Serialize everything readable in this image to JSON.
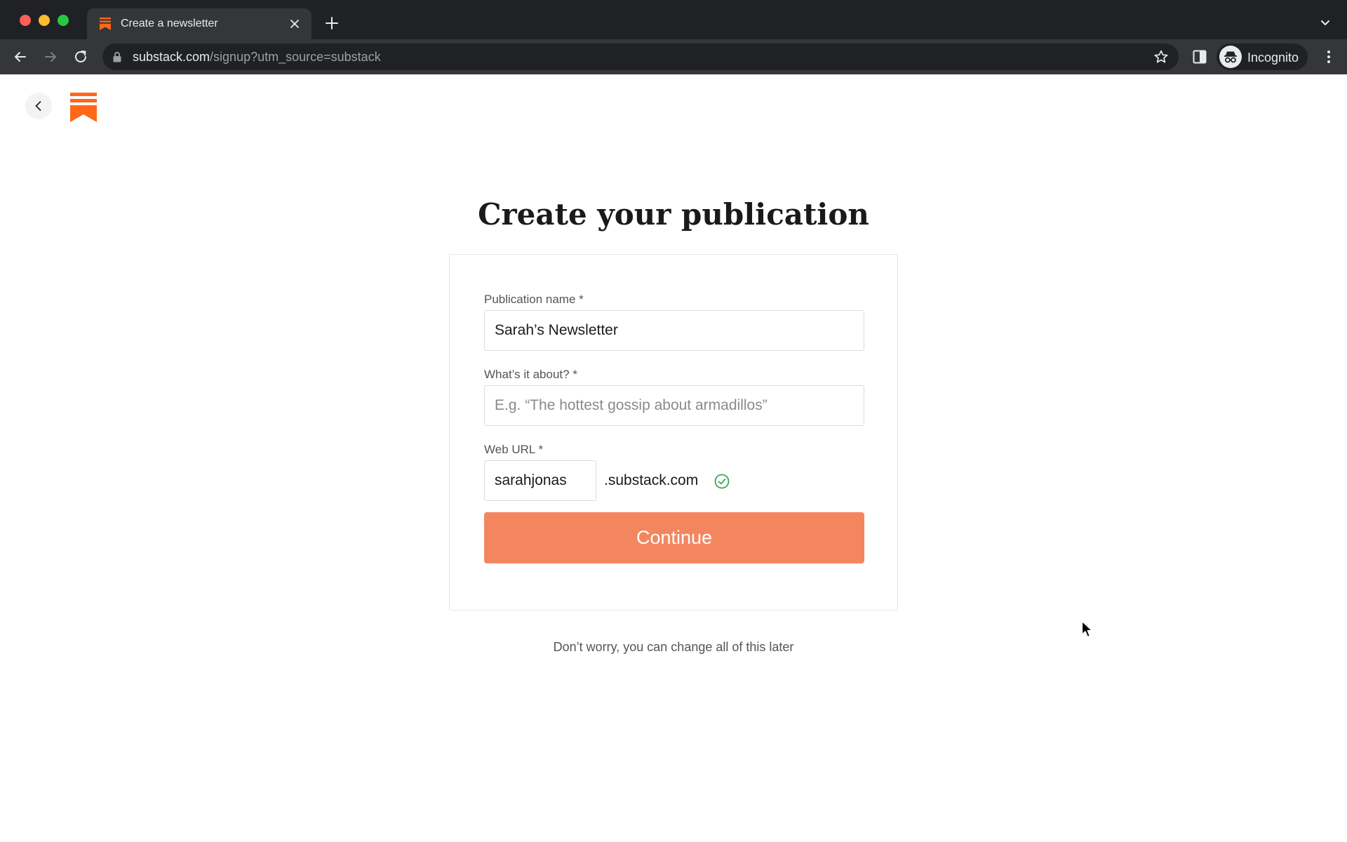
{
  "browser": {
    "tab": {
      "title": "Create a newsletter"
    },
    "address_bar": {
      "host": "substack.com",
      "path": "/signup?utm_source=substack"
    },
    "profile_label": "Incognito"
  },
  "page": {
    "title": "Create your publication",
    "form": {
      "publication_name": {
        "label": "Publication name *",
        "value": "Sarah’s Newsletter"
      },
      "about": {
        "label": "What’s it about? *",
        "placeholder": "E.g. “The hottest gossip about armadillos”",
        "value": ""
      },
      "web_url": {
        "label": "Web URL *",
        "value": "sarahjonas",
        "suffix": ".substack.com",
        "status": "available"
      },
      "submit_label": "Continue"
    },
    "footnote": "Don’t worry, you can change all of this later"
  },
  "colors": {
    "brand_orange": "#ff6719",
    "button": "#f4865f",
    "success": "#3aa757"
  }
}
